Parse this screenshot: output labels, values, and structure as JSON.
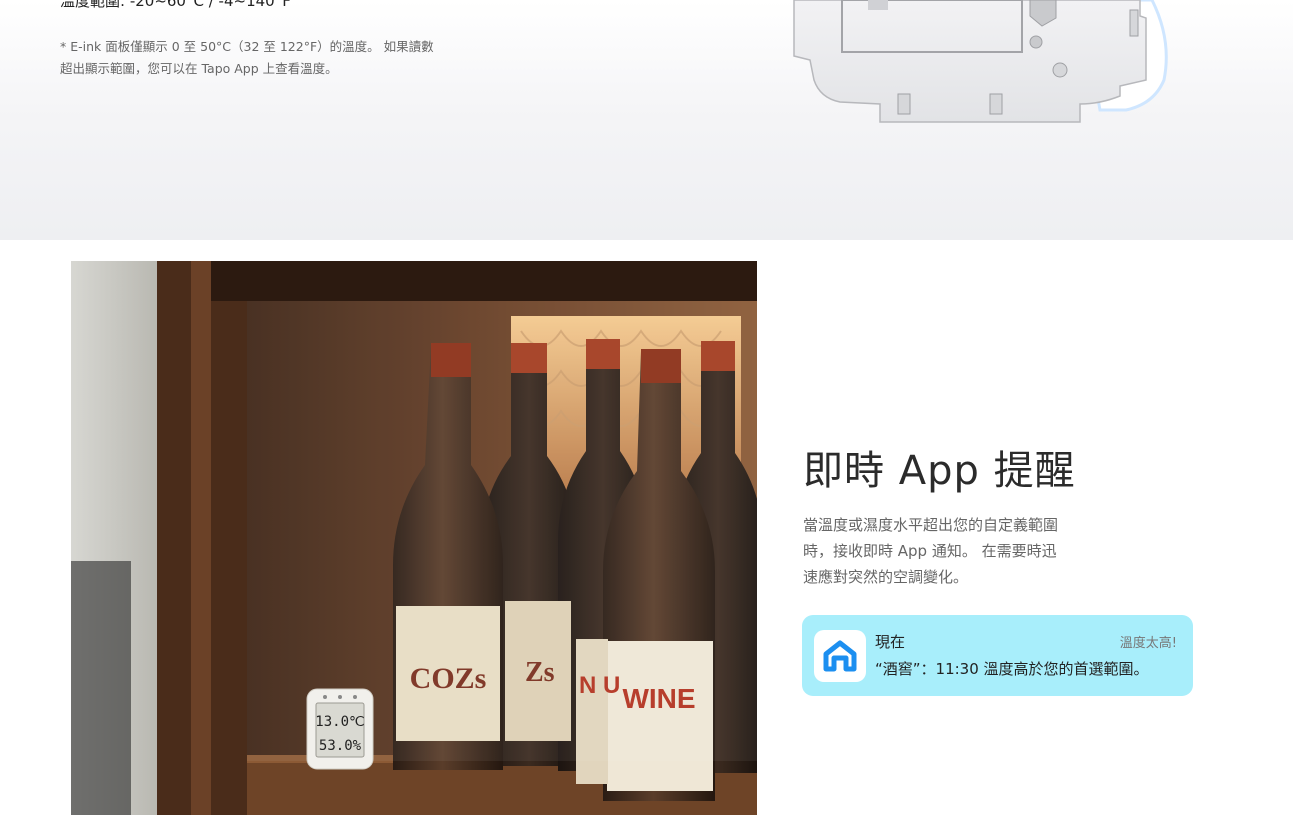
{
  "top": {
    "range_line": "溫度範圍: -20~60°C / -4~140°F",
    "note_lines": [
      "* E-ink 面板僅顯示 0 至 50°C（32 至 122°F）的溫度。 如果讀數",
      "超出顯示範圍，您可以在 Tapo App 上查看溫度。"
    ]
  },
  "feature": {
    "title": "即時 App 提醒",
    "description_lines": [
      "當溫度或濕度水平超出您的自定義範圍",
      "時，接收即時 App 通知。 在需要時迅",
      "速應對突然的空調變化。"
    ]
  },
  "photo": {
    "sensor_temp": "13.0℃",
    "sensor_humidity": "53.0%",
    "label_cozs": "COZs",
    "label_zs": "Zs",
    "label_wine": "WINE",
    "label_nu": "N U"
  },
  "notification": {
    "icon": "tapo-home-icon",
    "time": "現在",
    "alert": "溫度太高!",
    "message": "“酒窖”：11:30 溫度高於您的首選範圍。",
    "background": "#a8eefb",
    "icon_color": "#1c8ff0"
  }
}
